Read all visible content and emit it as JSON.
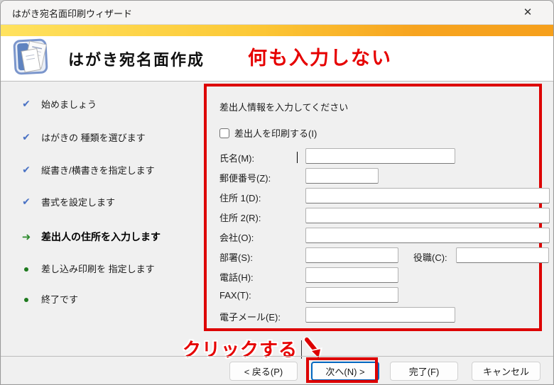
{
  "window": {
    "title": "はがき宛名面印刷ウィザード",
    "close_glyph": "✕"
  },
  "header": {
    "title": "はがき宛名面作成",
    "annotation": "何も入力しない"
  },
  "sidebar": {
    "steps": [
      {
        "label": "始めましょう",
        "state": "done"
      },
      {
        "label": "はがきの 種類を選びます",
        "state": "done"
      },
      {
        "label": "縦書き/横書きを指定します",
        "state": "done"
      },
      {
        "label": "書式を設定します",
        "state": "done"
      },
      {
        "label": "差出人の住所を入力します",
        "state": "current"
      },
      {
        "label": "差し込み印刷を 指定します",
        "state": "todo"
      },
      {
        "label": "終了です",
        "state": "todo"
      }
    ],
    "done_glyph": "✔",
    "current_glyph": "➜"
  },
  "form": {
    "heading": "差出人情報を入力してください",
    "checkbox": {
      "label": "差出人を印刷する(I)",
      "checked": false
    },
    "fields": {
      "name": {
        "label": "氏名(M):",
        "value": ""
      },
      "postal": {
        "label": "郵便番号(Z):",
        "value": ""
      },
      "address1": {
        "label": "住所 1(D):",
        "value": ""
      },
      "address2": {
        "label": "住所 2(R):",
        "value": ""
      },
      "company": {
        "label": "会社(O):",
        "value": ""
      },
      "department": {
        "label": "部署(S):",
        "value": ""
      },
      "position": {
        "label": "役職(C):",
        "value": ""
      },
      "phone": {
        "label": "電話(H):",
        "value": ""
      },
      "fax": {
        "label": "FAX(T):",
        "value": ""
      },
      "email": {
        "label": "電子メール(E):",
        "value": ""
      }
    }
  },
  "annotations": {
    "click_here": "クリックする"
  },
  "buttons": {
    "back": "< 戻る(P)",
    "next": "次へ(N) >",
    "finish": "完了(F)",
    "cancel": "キャンセル"
  },
  "colors": {
    "annotation_red": "#dd0000",
    "band_yellow": "#ffe25e",
    "band_orange": "#f6a01c",
    "check_blue": "#4a72c4",
    "step_green": "#2e8b2e",
    "focus_blue": "#0067c0"
  }
}
